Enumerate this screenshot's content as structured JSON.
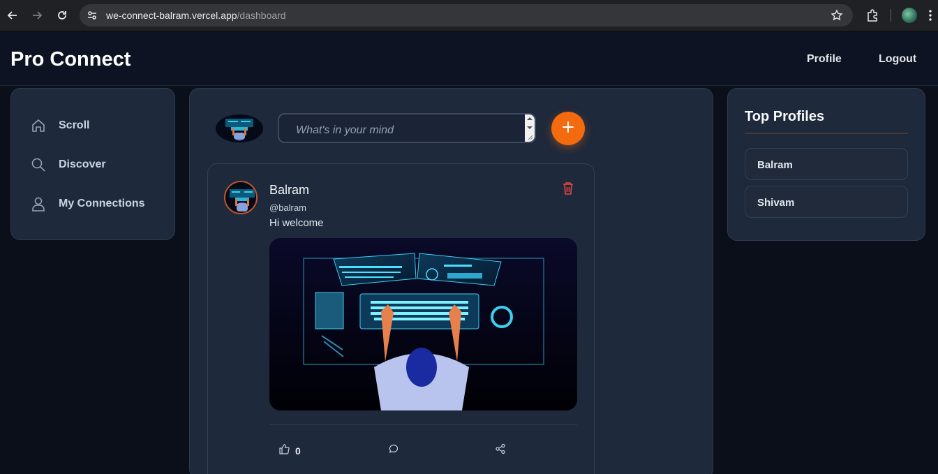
{
  "browser": {
    "url_host": "we-connect-balram.vercel.app",
    "url_path": "/dashboard"
  },
  "header": {
    "brand": "Pro Connect",
    "nav": {
      "profile": "Profile",
      "logout": "Logout"
    }
  },
  "sidebar": {
    "items": [
      {
        "label": "Scroll",
        "icon": "home-icon"
      },
      {
        "label": "Discover",
        "icon": "search-icon"
      },
      {
        "label": "My Connections",
        "icon": "user-icon"
      }
    ]
  },
  "composer": {
    "placeholder": "What's in your mind",
    "add_icon": "plus-icon"
  },
  "post": {
    "author": "Balram",
    "handle": "@balram",
    "text": "Hi welcome",
    "likes": "0",
    "icons": [
      "delete-icon",
      "like-icon",
      "comment-icon",
      "share-icon"
    ]
  },
  "top_profiles": {
    "title": "Top Profiles",
    "items": [
      "Balram",
      "Shivam"
    ]
  },
  "colors": {
    "accent": "#f46a0e",
    "delete": "#ef4444",
    "card": "#1e293b",
    "background": "#0b0f1a"
  }
}
